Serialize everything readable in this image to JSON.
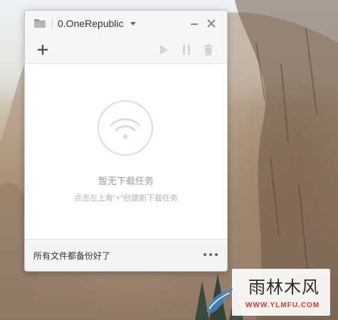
{
  "window": {
    "title": "0.OneRepublic"
  },
  "toolbar": {
    "add_icon": "plus-icon",
    "start_icon": "play-icon",
    "pause_icon": "pause-icon",
    "delete_icon": "trash-icon"
  },
  "empty_state": {
    "icon": "wifi-icon",
    "title": "暂无下载任务",
    "hint": "点击左上角\"+\"创建新下载任务"
  },
  "statusbar": {
    "text": "所有文件都备份好了",
    "more_icon": "more-dots-icon"
  },
  "watermark": {
    "name": "雨林木风",
    "url": "WWW.YLMFU.COM"
  },
  "colors": {
    "window_bg": "#ffffff",
    "titlebar_bg": "#f6f6f6",
    "statusbar_bg": "#f4f4f4",
    "icon_gray": "#cfcfcf",
    "text_dark": "#333333",
    "watermark_url": "#d43a2f"
  }
}
